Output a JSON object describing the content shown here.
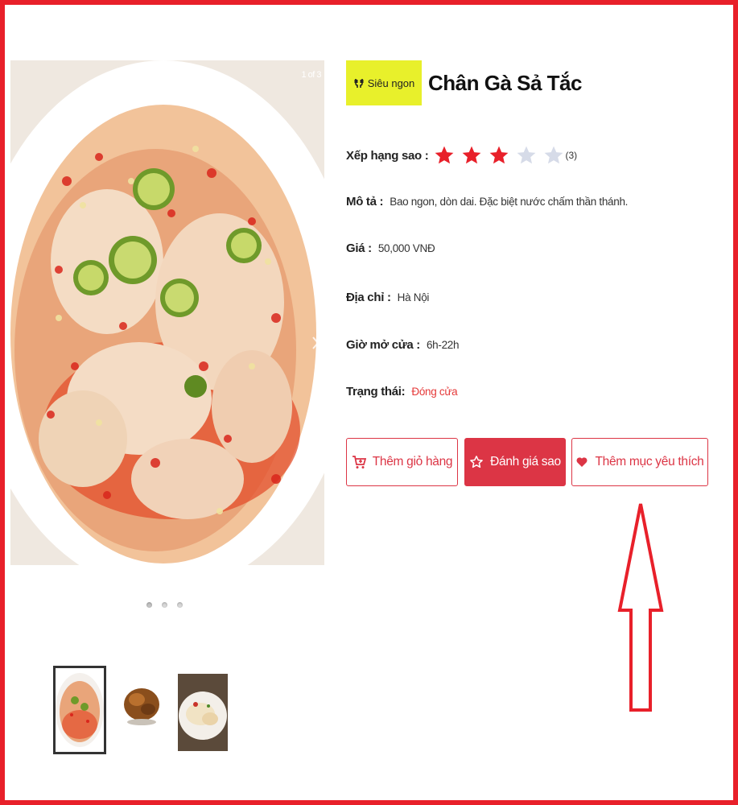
{
  "gallery": {
    "counter": "1 of 3",
    "dots_count": 3,
    "active_dot": 1,
    "thumbnails": [
      "chan-ga-sa-tac",
      "roast-chicken",
      "boiled-chicken"
    ],
    "selected_thumbnail": 1
  },
  "product": {
    "badge_label": "Siêu ngon",
    "badge_icon": "glasses-icon",
    "title": "Chân Gà Sả Tắc",
    "rating_label": "Xếp hạng sao :",
    "rating_value": 3,
    "rating_max": 5,
    "rating_count": "(3)",
    "description_label": "Mô tả :",
    "description": "Bao ngon, dòn dai. Đặc biệt nước chấm thần thánh.",
    "price_label": "Giá :",
    "price": "50,000 VNĐ",
    "address_label": "Địa chỉ :",
    "address": "Hà Nội",
    "hours_label": "Giờ mở cửa :",
    "hours": "6h-22h",
    "status_label": "Trạng thái:",
    "status": "Đóng cửa"
  },
  "actions": {
    "add_cart": "Thêm giỏ hàng",
    "rate": "Đánh giá sao",
    "favorite": "Thêm mục yêu thích"
  },
  "colors": {
    "accent": "#dc3545",
    "badge_bg": "#e8f02b",
    "star_filled": "#e8202a",
    "star_empty": "#d6dbe8",
    "annotation": "#e8202a"
  }
}
